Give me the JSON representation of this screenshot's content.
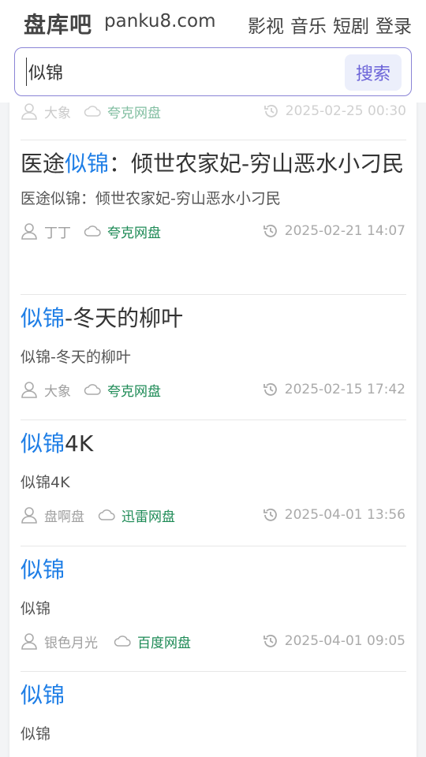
{
  "header": {
    "logo": "盘库吧",
    "domain": "panku8.com",
    "nav": [
      "影视",
      "音乐",
      "短剧",
      "登录"
    ]
  },
  "search": {
    "value": "似锦",
    "button": "搜索"
  },
  "partial_row": {
    "user": "大象",
    "source": "夸克网盘",
    "time": "2025-02-25 00:30"
  },
  "results": [
    {
      "title_before": "医途",
      "title_hl": "似锦",
      "title_after": "：倾世农家妃-穷山恶水小刁民",
      "desc": "医途似锦：倾世农家妃-穷山恶水小刁民",
      "user": "丁丁",
      "source": "夸克网盘",
      "time": "2025-02-21 14:07"
    },
    {
      "title_before": "",
      "title_hl": "似锦",
      "title_after": "-冬天的柳叶",
      "desc": "似锦-冬天的柳叶",
      "user": "大象",
      "source": "夸克网盘",
      "time": "2025-02-15 17:42"
    },
    {
      "title_before": "",
      "title_hl": "似锦",
      "title_after": "4K",
      "desc": "似锦4K",
      "user": "盘啊盘",
      "source": "迅雷网盘",
      "time": "2025-04-01 13:56"
    },
    {
      "title_before": "",
      "title_hl": "似锦",
      "title_after": "",
      "desc": "似锦",
      "user": "银色月光",
      "source": "百度网盘",
      "time": "2025-04-01 09:05"
    },
    {
      "title_before": "",
      "title_hl": "似锦",
      "title_after": "",
      "desc": "似锦"
    }
  ]
}
